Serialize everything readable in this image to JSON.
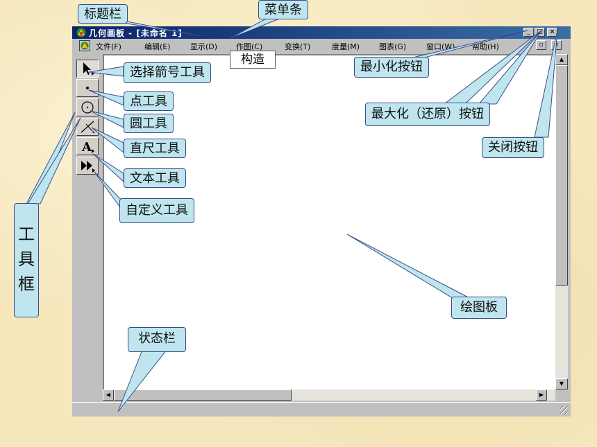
{
  "window": {
    "title": "几何画板 - [未命名 1]",
    "caption_buttons": {
      "minimize": "_",
      "maximize": "□",
      "close": "×"
    },
    "mdi_buttons": {
      "restore": "▫",
      "close": "×"
    }
  },
  "menu": {
    "items": [
      {
        "label": "文件(F)"
      },
      {
        "label": "编辑(E)"
      },
      {
        "label": "显示(D)"
      },
      {
        "label": "作图(C)"
      },
      {
        "label": "变换(T)"
      },
      {
        "label": "度量(M)"
      },
      {
        "label": "图表(G)"
      },
      {
        "label": "窗口(W)"
      },
      {
        "label": "帮助(H)"
      }
    ],
    "construct_popup": "构造"
  },
  "tools": [
    {
      "icon": "arrow-select-icon",
      "glyph": "↖"
    },
    {
      "icon": "point-tool-icon",
      "glyph": "•"
    },
    {
      "icon": "circle-tool-icon",
      "glyph": "⊙"
    },
    {
      "icon": "straightedge-tool-icon",
      "glyph": "/"
    },
    {
      "icon": "text-tool-icon",
      "glyph": "A"
    },
    {
      "icon": "custom-tool-icon",
      "glyph": "▸▸"
    }
  ],
  "labels": {
    "title_bar": "标题栏",
    "menu_bar": "菜单条",
    "minimize_button": "最小化按钮",
    "maximize_button": "最大化（还原）按钮",
    "close_button": "关闭按钮",
    "select_arrow_tool": "选择箭号工具",
    "point_tool": "点工具",
    "circle_tool": "圆工具",
    "straightedge_tool": "直尺工具",
    "text_tool": "文本工具",
    "custom_tool": "自定义工具",
    "toolbox": [
      "工",
      "具",
      "框"
    ],
    "drawing_board": "绘图板",
    "status_bar": "状态栏"
  },
  "colors": {
    "background": "#f6e7bd",
    "callout_fill": "#bfe5ee",
    "callout_border": "#3a4a8a",
    "title_bar_start": "#0a246a",
    "title_bar_end": "#3a6ea5",
    "window_chrome": "#c0c0c0"
  }
}
